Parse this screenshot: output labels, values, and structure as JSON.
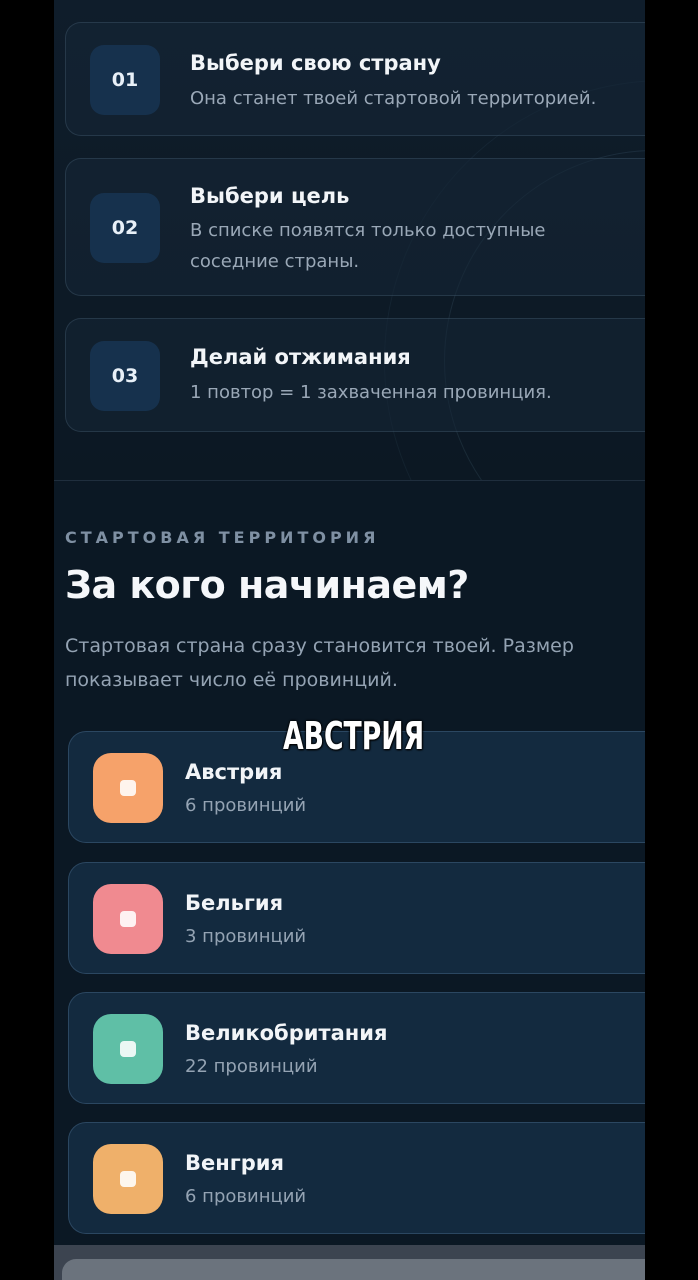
{
  "steps": [
    {
      "num": "01",
      "title": "Выбери свою страну",
      "desc": [
        "Она станет твоей стартовой территорией."
      ]
    },
    {
      "num": "02",
      "title": "Выбери цель",
      "desc": [
        "В списке появятся только доступные",
        "соседние страны."
      ]
    },
    {
      "num": "03",
      "title": "Делай отжимания",
      "desc": [
        "1 повтор = 1 захваченная провинция."
      ]
    }
  ],
  "section": {
    "kicker": "СТАРТОВАЯ ТЕРРИТОРИЯ",
    "heading": "За кого начинаем?",
    "sub_line1": "Стартовая страна сразу становится твоей. Размер",
    "sub_line2": "показывает число её провинций."
  },
  "caption": "АВСТРИЯ",
  "countries": [
    {
      "name": "Австрия",
      "count": "6 провинций",
      "color": "#f6a26a"
    },
    {
      "name": "Бельгия",
      "count": "3 провинций",
      "color": "#f08a90"
    },
    {
      "name": "Великобритания",
      "count": "22 провинций",
      "color": "#5fbfa6"
    },
    {
      "name": "Венгрия",
      "count": "6 провинций",
      "color": "#efb06a"
    }
  ]
}
